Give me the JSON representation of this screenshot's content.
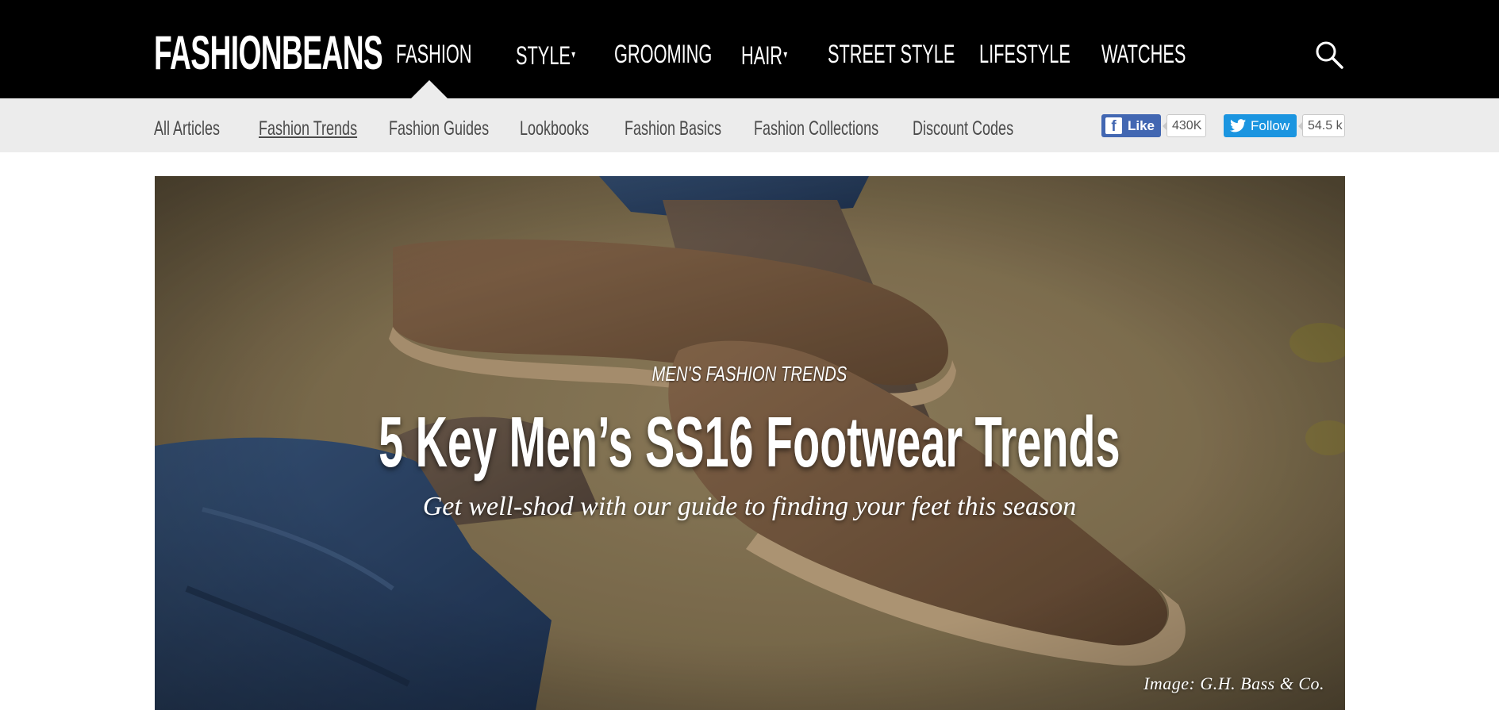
{
  "header": {
    "logo": "FASHIONBEANS",
    "nav": [
      {
        "label": "FASHION",
        "caret": ""
      },
      {
        "label": "STYLE",
        "caret": "▾"
      },
      {
        "label": "GROOMING",
        "caret": ""
      },
      {
        "label": "HAIR",
        "caret": "▾"
      },
      {
        "label": "STREET STYLE",
        "caret": ""
      },
      {
        "label": "LIFESTYLE",
        "caret": ""
      },
      {
        "label": "WATCHES",
        "caret": ""
      }
    ],
    "search_icon": "search-icon"
  },
  "subnav": {
    "items": [
      {
        "label": "All Articles"
      },
      {
        "label": "Fashion Trends"
      },
      {
        "label": "Fashion Guides"
      },
      {
        "label": "Lookbooks"
      },
      {
        "label": "Fashion Basics"
      },
      {
        "label": "Fashion Collections"
      },
      {
        "label": "Discount Codes"
      }
    ],
    "facebook": {
      "label": "Like",
      "count": "430K",
      "icon": "facebook-icon"
    },
    "twitter": {
      "label": "Follow",
      "count": "54.5 k",
      "icon": "twitter-bird-icon"
    }
  },
  "hero": {
    "kicker": "MEN'S FASHION TRENDS",
    "title": "5 Key Men’s SS16 Footwear Trends",
    "subtitle": "Get well-shod with our guide to finding your feet this season",
    "credit": "Image: G.H. Bass & Co."
  },
  "colors": {
    "topbar": "#000000",
    "subbar": "#ececec",
    "facebook": "#4267b2",
    "twitter": "#1b95e0"
  }
}
